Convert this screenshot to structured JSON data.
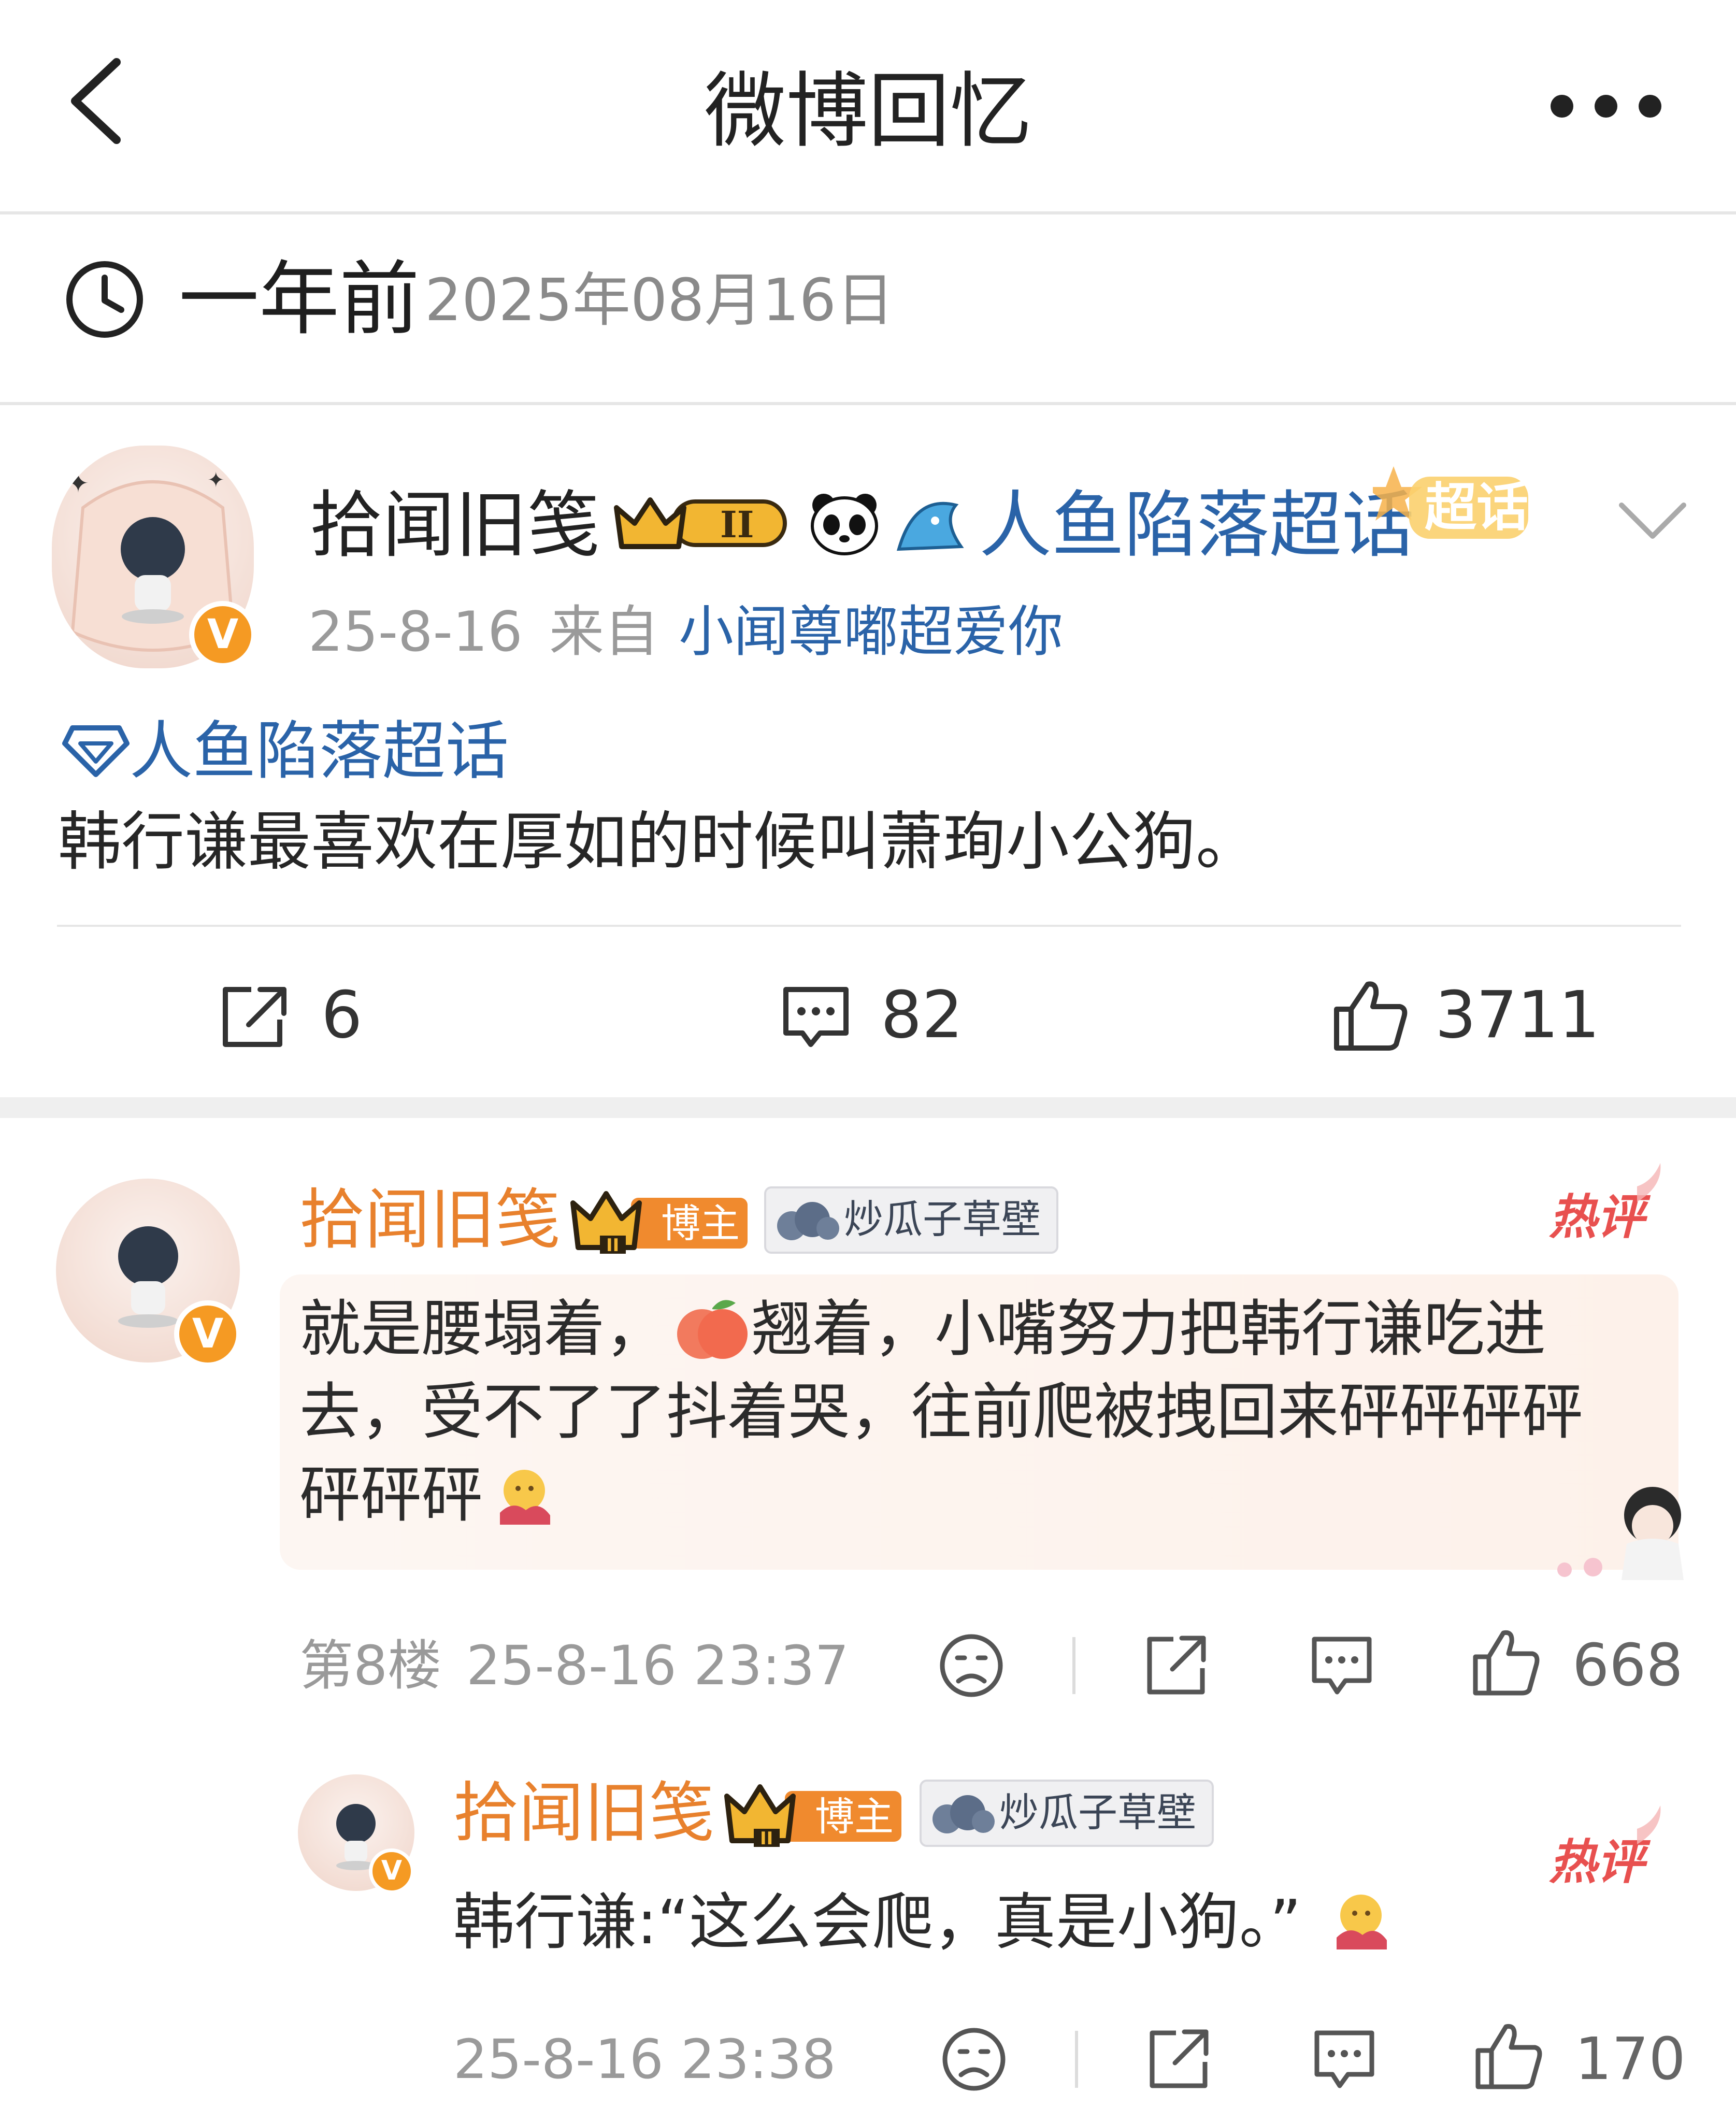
{
  "header": {
    "title": "微博回忆"
  },
  "memory": {
    "label": "一年前",
    "date": "2025年08月16日"
  },
  "post": {
    "author": "拾闻旧笺",
    "level_badge": "II",
    "supertopic_link": "人鱼陷落超话",
    "supertopic_chip": "超话",
    "time": "25-8-16",
    "from_label": "来自",
    "source": "小闻尊嘟超爱你",
    "topic_tag": "人鱼陷落超话",
    "text": "韩行谦最喜欢在厚如的时候叫萧珣小公狗。",
    "repost_count": "6",
    "comment_count": "82",
    "like_count": "3711"
  },
  "comments": [
    {
      "author": "拾闻旧笺",
      "role_badge": "博主",
      "level": "II",
      "fan_badge": "炒瓜子草壁",
      "hot_label": "热评",
      "line1_a": "就是腰塌着，",
      "line1_b": "翘着，小嘴努力把韩行谦吃进",
      "line2": "去，受不了了抖着哭，往前爬被拽回来砰砰砰砰",
      "line3": "砰砰砰",
      "floor": "第8楼",
      "time": "25-8-16 23:37",
      "likes": "668"
    },
    {
      "author": "拾闻旧笺",
      "role_badge": "博主",
      "level": "II",
      "fan_badge": "炒瓜子草壁",
      "hot_label": "热评",
      "text": "韩行谦:“这么会爬，真是小狗。”",
      "time": "25-8-16 23:38",
      "likes": "170"
    }
  ],
  "colors": {
    "link_blue": "#2a63a8",
    "author_orange": "#e8812d",
    "verified_orange": "#f59a23",
    "hot_red": "#e8504f",
    "divider": "#e6e6e6",
    "section_gap": "#efefef",
    "comment_bubble": "#fdf1ea"
  },
  "icons": [
    "back-icon",
    "more-icon",
    "clock-icon",
    "crown-icon",
    "panda-icon",
    "shark-icon",
    "chevron-down-icon",
    "diamond-icon",
    "repost-icon",
    "comment-icon",
    "like-icon",
    "dislike-icon",
    "share-icon"
  ]
}
